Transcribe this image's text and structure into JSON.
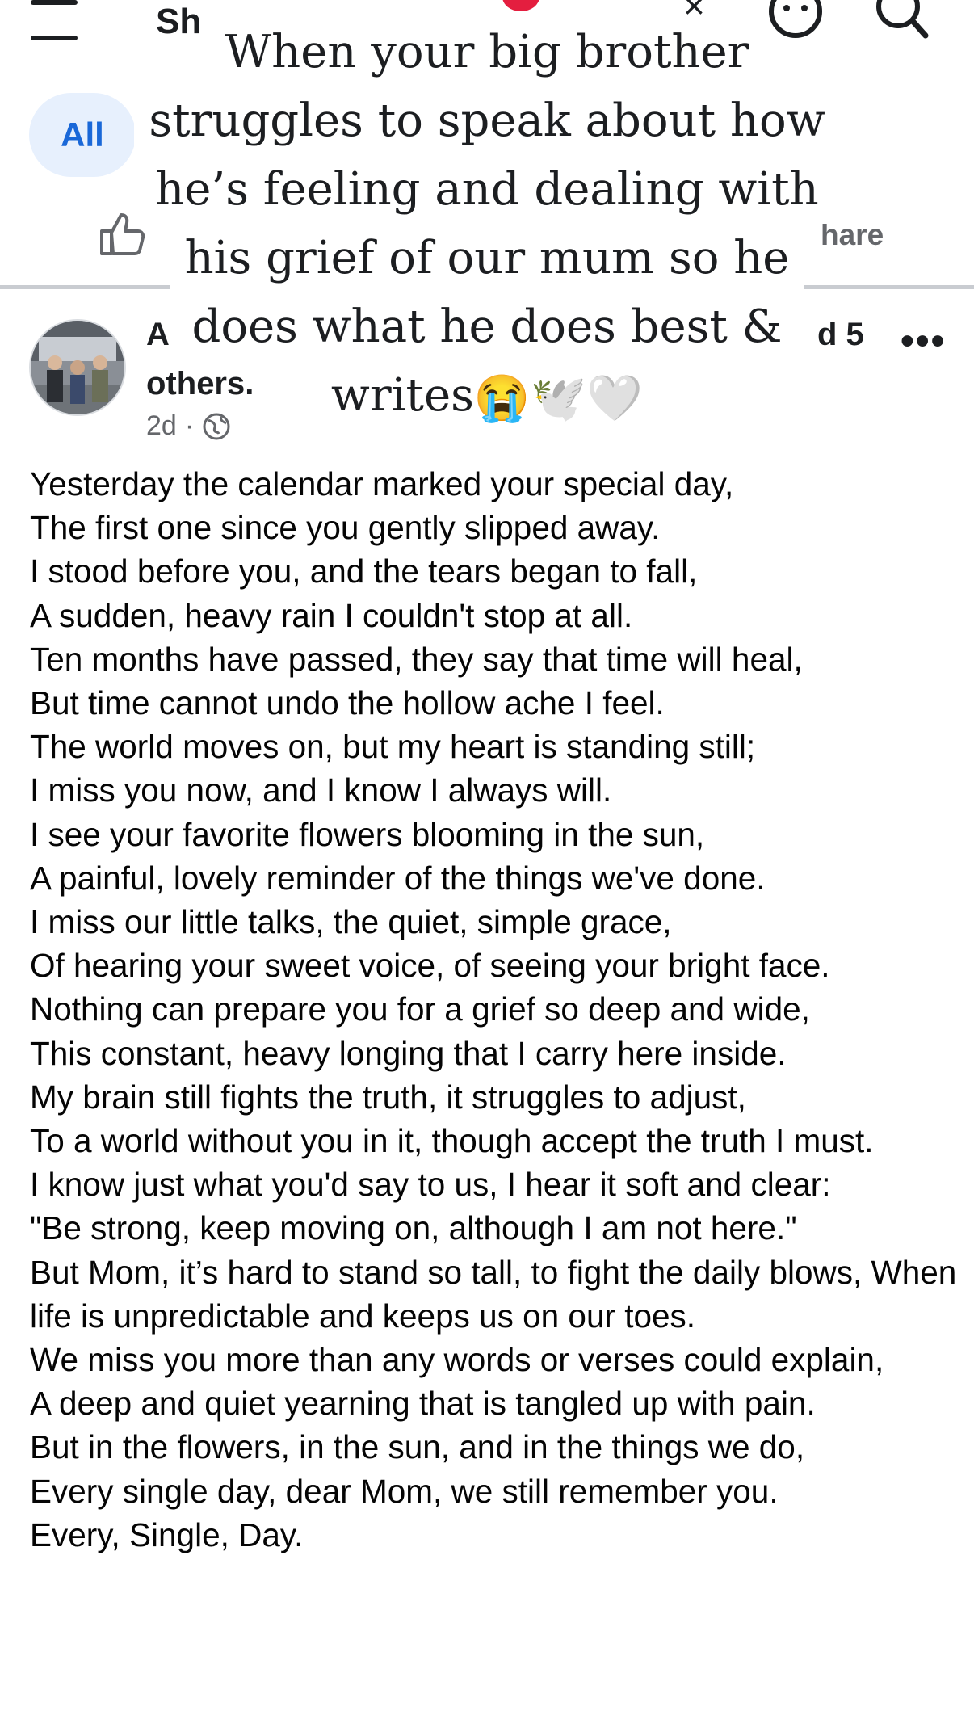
{
  "header": {
    "title_visible": "Sh",
    "menu_icon": "hamburger-menu-icon",
    "messenger_icon": "smiley-face-icon",
    "search_icon": "search-icon",
    "accent_red": "#e41e3f"
  },
  "filters": {
    "all_label": "All",
    "all_bg": "#e7f0fd",
    "all_color": "#1a68d8"
  },
  "actions": {
    "like_icon": "thumbs-up-icon",
    "share_label_visible": "hare"
  },
  "overlay_caption": {
    "lines": [
      "When your big brother",
      "struggles to speak about how",
      "he’s feeling and dealing with",
      "his grief of our mum so he",
      "does what he does best &",
      "writes"
    ],
    "emojis": [
      "😭",
      "🕊️",
      "🤍"
    ]
  },
  "post": {
    "author_start": "A",
    "author_end": "d 5",
    "author_others": "others.",
    "time": "2d",
    "separator": "·",
    "audience_icon": "globe-icon",
    "more_icon": "more-dots-icon",
    "poem_lines": [
      "Yesterday the calendar marked your special day,",
      "The first one since you gently slipped away.",
      "I stood before you, and the tears began to fall,",
      "A sudden, heavy rain I couldn't stop at all.",
      "Ten months have passed, they say that time will heal,",
      "But time cannot undo the hollow ache I feel.",
      "The world moves on, but my heart is standing still;",
      "I miss you now, and I know I always will.",
      "I see your favorite flowers blooming in the sun,",
      "A painful, lovely reminder of the things we've done.",
      "I miss our little talks, the quiet, simple grace,",
      "Of hearing your sweet voice, of seeing your bright face.",
      "Nothing can prepare you for a grief so deep and wide,",
      "This constant, heavy longing that I carry here inside.",
      "My brain still fights the truth, it struggles to adjust,",
      "To a world without you in it, though accept the truth I must.",
      "I know just what you'd say to us, I hear it soft and clear:",
      "\"Be strong, keep moving on, although I am not here.\"",
      "But Mom, it’s hard to stand so tall, to fight the daily blows, When life is unpredictable and keeps us on our toes.",
      "We miss you more than any words or verses could explain,",
      "A deep and quiet yearning that is tangled up with pain.",
      "But in the flowers, in the sun, and in the things we do,",
      "Every single day, dear Mom, we still remember you.",
      "Every, Single, Day."
    ]
  }
}
